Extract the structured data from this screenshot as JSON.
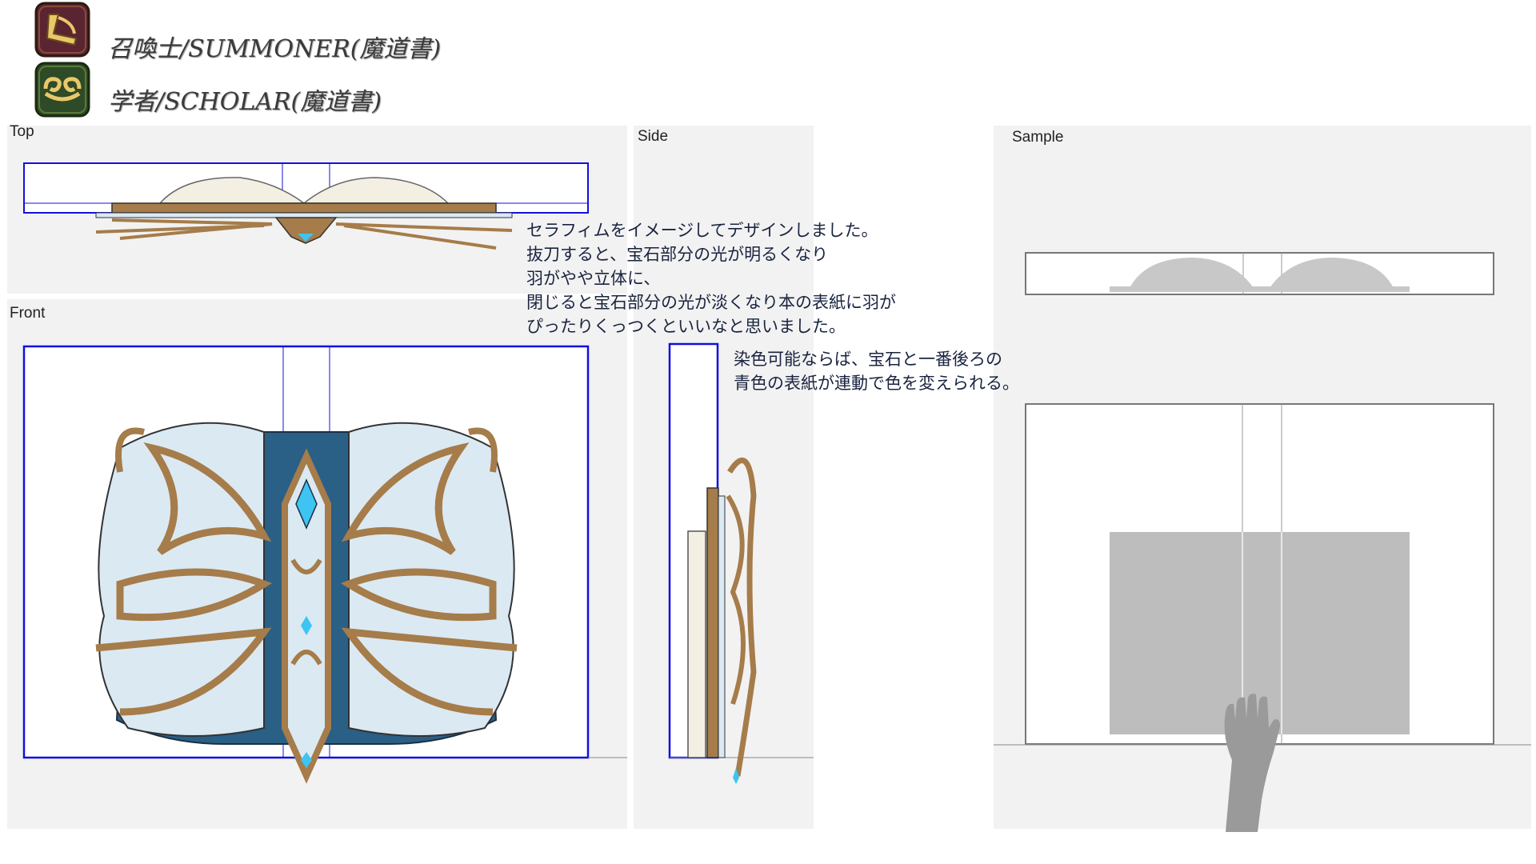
{
  "header": {
    "jobs": [
      {
        "icon": "summoner-job-icon",
        "label": "召喚士/SUMMONER(魔道書)",
        "icon_bg": "#5a2530",
        "icon_fg": "#e9c76a"
      },
      {
        "icon": "scholar-job-icon",
        "label": "学者/SCHOLAR(魔道書)",
        "icon_bg": "#2f4a26",
        "icon_fg": "#e9c76a"
      }
    ]
  },
  "panels": {
    "top_label": "Top",
    "front_label": "Front",
    "side_label": "Side",
    "sample_label": "Sample"
  },
  "notes": {
    "design_note": "セラフィムをイメージしてデザインしました。\n抜刀すると、宝石部分の光が明るくなり\n羽がやや立体に、\n閉じると宝石部分の光が淡くなり本の表紙に羽が\nぴったりくっつくといいなと思いました。",
    "dye_note": "染色可能ならば、宝石と一番後ろの\n青色の表紙が連動で色を変えられる。"
  },
  "colors": {
    "guide_blue": "#1010e0",
    "wood_brown": "#a57c4a",
    "pale_blue": "#dbe9f3",
    "dark_blue": "#2a5f86",
    "gem_cyan": "#3ec4f0",
    "panel_gray": "#f2f2f2",
    "sample_gray": "#bdbdbd"
  }
}
